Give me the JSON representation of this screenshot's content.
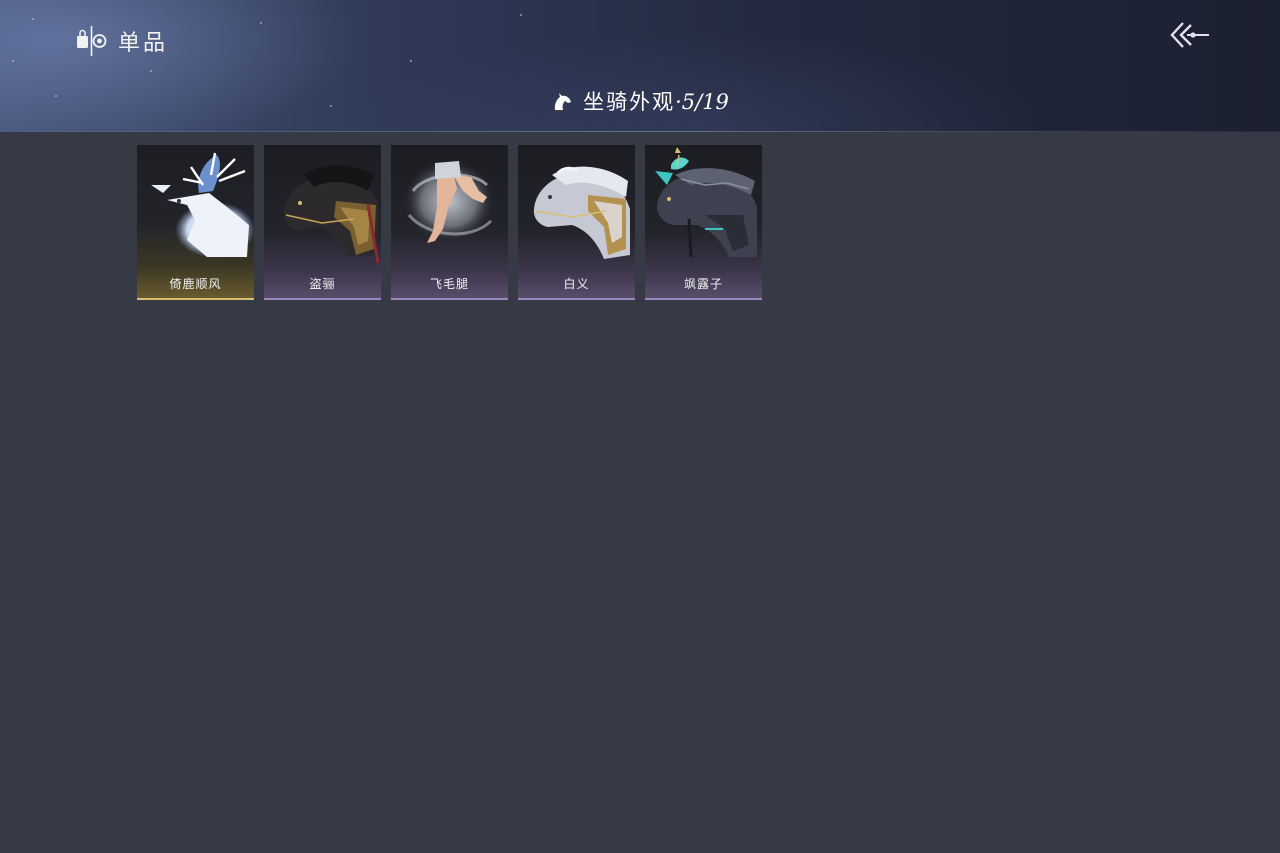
{
  "header": {
    "title": "单品",
    "brand_icon": "bag-and-eye-icon",
    "back_icon": "back-arrow-icon"
  },
  "section": {
    "icon": "horse-head-icon",
    "title": "坐骑外观",
    "count": "·5/19"
  },
  "items": [
    {
      "name": "倚鹿顺风",
      "art": "white-deer-icon",
      "selected": true
    },
    {
      "name": "盗骊",
      "art": "dark-armored-horse-icon",
      "selected": false
    },
    {
      "name": "飞毛腿",
      "art": "flying-legs-icon",
      "selected": false
    },
    {
      "name": "白义",
      "art": "white-horse-icon",
      "selected": false
    },
    {
      "name": "飒露子",
      "art": "jade-crowned-horse-icon",
      "selected": false
    }
  ],
  "colors": {
    "background": "#363a44",
    "header_dark": "#1b2030",
    "selected_accent": "#d8c070",
    "card_accent": "#9a86c2"
  }
}
